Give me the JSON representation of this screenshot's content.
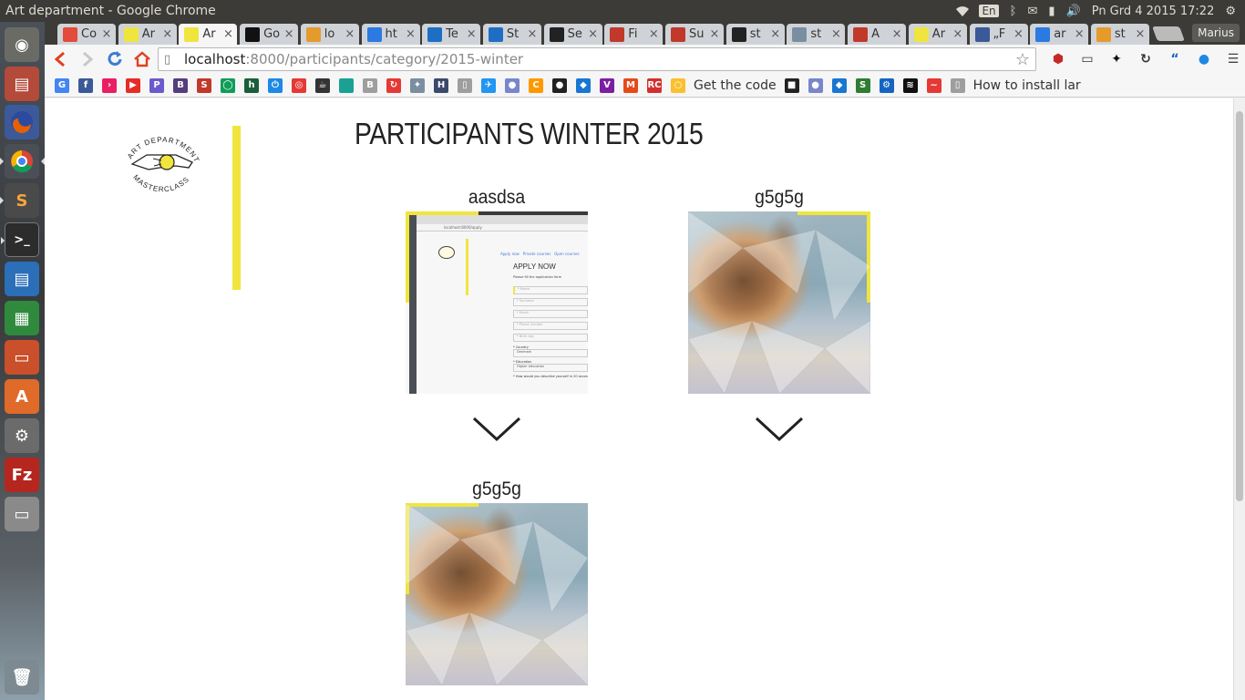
{
  "window": {
    "title": "Art department - Google Chrome"
  },
  "panel": {
    "keyboard_layout": "En",
    "datetime": "Pn Grd  4 2015 17:22",
    "icons": [
      "wifi-icon",
      "keyboard-icon",
      "bluetooth-icon",
      "mail-icon",
      "battery-icon",
      "volume-icon",
      "settings-icon"
    ]
  },
  "launcher": {
    "items": [
      "dash-icon",
      "files-icon",
      "firefox-icon",
      "chrome-icon",
      "sublime-icon",
      "terminal-icon",
      "writer-icon",
      "calc-icon",
      "impress-icon",
      "software-center-icon",
      "system-settings-icon",
      "filezilla-icon",
      "drive-icon",
      "trash-icon"
    ]
  },
  "tabs": [
    {
      "label": "Co",
      "icon": "laravel-icon",
      "color": "#e34b3b"
    },
    {
      "label": "Ar",
      "icon": "art-dept-icon",
      "color": "#f0e53f"
    },
    {
      "label": "Ar",
      "icon": "art-dept-icon",
      "color": "#f0e53f",
      "active": true
    },
    {
      "label": "Go",
      "icon": "flag-icon",
      "color": "#111111"
    },
    {
      "label": "lo",
      "icon": "phpmyadmin-icon",
      "color": "#e59a2c"
    },
    {
      "label": "ht",
      "icon": "d-icon",
      "color": "#2a7ae2"
    },
    {
      "label": "Te",
      "icon": "s-icon",
      "color": "#1e6fc4"
    },
    {
      "label": "St",
      "icon": "s-icon",
      "color": "#1e6fc4"
    },
    {
      "label": "Se",
      "icon": "github-icon",
      "color": "#222222"
    },
    {
      "label": "Fi",
      "icon": "l-icon",
      "color": "#c0392b"
    },
    {
      "label": "Su",
      "icon": "l-icon",
      "color": "#c0392b"
    },
    {
      "label": "st",
      "icon": "github-icon",
      "color": "#222222"
    },
    {
      "label": "st",
      "icon": "owl-icon",
      "color": "#7a8ea0"
    },
    {
      "label": "A",
      "icon": "l-icon",
      "color": "#c0392b"
    },
    {
      "label": "Ar",
      "icon": "art-dept-icon",
      "color": "#f0e53f"
    },
    {
      "label": "„F",
      "icon": "facebook-icon",
      "color": "#3b5998"
    },
    {
      "label": "ar",
      "icon": "v-icon",
      "color": "#2a7ae2"
    },
    {
      "label": "st",
      "icon": "phpmyadmin-icon",
      "color": "#e59a2c"
    }
  ],
  "profile": {
    "name": "Marius"
  },
  "omnibox": {
    "host": "localhost",
    "path": ":8000/participants/category/2015-winter"
  },
  "bookmarks": {
    "items": [
      {
        "icon": "google-icon",
        "color": "#4285f4",
        "glyph": "G"
      },
      {
        "icon": "facebook-icon",
        "color": "#3b5998",
        "glyph": "f"
      },
      {
        "icon": "play-icon",
        "color": "#e91e63",
        "glyph": "›"
      },
      {
        "icon": "youtube-icon",
        "color": "#e52d27",
        "glyph": "▶"
      },
      {
        "icon": "php-icon",
        "color": "#6a5acd",
        "glyph": "P"
      },
      {
        "icon": "bootstrap-icon",
        "color": "#563d7c",
        "glyph": "B"
      },
      {
        "icon": "s-icon",
        "color": "#c0392b",
        "glyph": "S"
      },
      {
        "icon": "hangouts-icon",
        "color": "#0f9d58",
        "glyph": "◯"
      },
      {
        "icon": "h-icon",
        "color": "#1a5e3a",
        "glyph": "h"
      },
      {
        "icon": "power-icon",
        "color": "#1e88e5",
        "glyph": "⏻"
      },
      {
        "icon": "target-icon",
        "color": "#e53935",
        "glyph": "◎"
      },
      {
        "icon": "cup-icon",
        "color": "#333333",
        "glyph": "☕"
      },
      {
        "icon": "teal-square-icon",
        "color": "#1aa194",
        "glyph": " "
      },
      {
        "icon": "b-icon",
        "color": "#9e9e9e",
        "glyph": "B"
      },
      {
        "icon": "refresh-red-icon",
        "color": "#e53935",
        "glyph": "↻"
      },
      {
        "icon": "owl-icon",
        "color": "#7a8ea0",
        "glyph": "✦"
      },
      {
        "icon": "h-icon",
        "color": "#3b4a6b",
        "glyph": "H"
      },
      {
        "icon": "page-icon",
        "color": "#9e9e9e",
        "glyph": "▯"
      },
      {
        "icon": "bird-icon",
        "color": "#2196f3",
        "glyph": "✈"
      },
      {
        "icon": "circle-icon",
        "color": "#7986cb",
        "glyph": "●"
      },
      {
        "icon": "c-icon",
        "color": "#ff9800",
        "glyph": "C"
      },
      {
        "icon": "github-icon",
        "color": "#222222",
        "glyph": "●"
      },
      {
        "icon": "drop-icon",
        "color": "#1976d2",
        "glyph": "◆"
      },
      {
        "icon": "v-icon",
        "color": "#7b1fa2",
        "glyph": "V"
      },
      {
        "icon": "m-icon",
        "color": "#e64a19",
        "glyph": "M"
      },
      {
        "icon": "rc-icon",
        "color": "#d32f2f",
        "glyph": "RC"
      },
      {
        "icon": "ring-icon",
        "color": "#fbc02d",
        "glyph": "○"
      }
    ],
    "get_the_code": "Get the code",
    "trailing_icons": [
      {
        "icon": "dark-square-icon",
        "color": "#222222",
        "glyph": "■"
      },
      {
        "icon": "circle-icon",
        "color": "#7986cb",
        "glyph": "●"
      },
      {
        "icon": "drop-icon",
        "color": "#1976d2",
        "glyph": "◆"
      },
      {
        "icon": "s-circle-icon",
        "color": "#2e7d32",
        "glyph": "S"
      },
      {
        "icon": "gear-icon",
        "color": "#1565c0",
        "glyph": "⚙"
      },
      {
        "icon": "wifi-icon",
        "color": "#111111",
        "glyph": "≋"
      },
      {
        "icon": "swirl-icon",
        "color": "#e53935",
        "glyph": "~"
      },
      {
        "icon": "page-icon",
        "color": "#9e9e9e",
        "glyph": "▯"
      }
    ],
    "install": "How to install lar"
  },
  "page": {
    "logo_text_top": "ART DEPARTMENT",
    "logo_text_bottom": "MASTERCLASS",
    "title": "PARTICIPANTS WINTER 2015",
    "accent_color": "#f0e53f",
    "participants": [
      {
        "name": "aasdsa",
        "image": "screenshot"
      },
      {
        "name": "g5g5g",
        "image": "lowpoly"
      },
      {
        "name": "g5g5g",
        "image": "lowpoly"
      }
    ],
    "preview": {
      "url": "localhost:8000/apply",
      "nav": [
        "Apply now",
        "Private courses",
        "Open courses"
      ],
      "heading": "APPLY NOW",
      "intro": "Please fill the application form",
      "fields": [
        "* Name",
        "* Surname",
        "* Email",
        "* Phone number",
        "* Birth day"
      ],
      "country_label": "* Country",
      "country_value": "Denmark",
      "education_label": "* Education",
      "education_value": "Higher education",
      "describe": "* How would you describe yourself in 20 seconds making a"
    }
  }
}
